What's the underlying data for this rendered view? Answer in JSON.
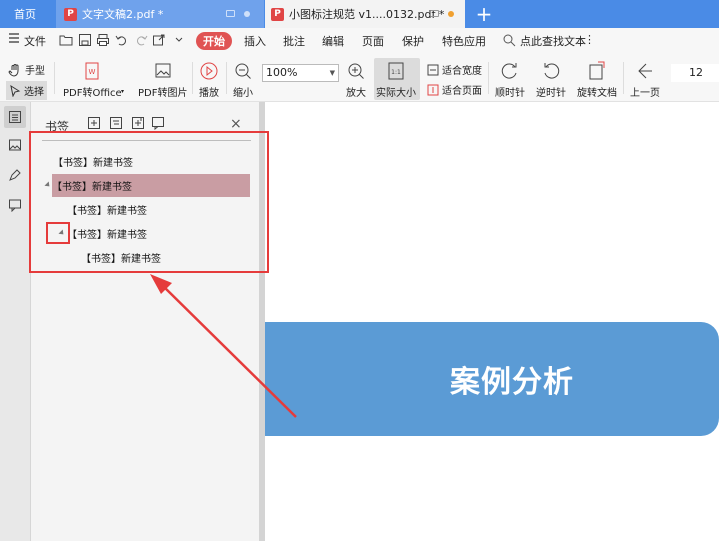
{
  "tabs": {
    "home": "首页",
    "doc1": "文字文稿2.pdf *",
    "doc2": "小图标注规范 v1....0132.pdf *",
    "add": "+"
  },
  "menu": {
    "file": "文件",
    "start": "开始",
    "insert": "插入",
    "annotate": "批注",
    "edit": "编辑",
    "page": "页面",
    "protect": "保护",
    "features": "特色应用",
    "search_placeholder": "点此查找文本",
    "more": "⋮"
  },
  "ribbon": {
    "hand": "手型",
    "select": "选择",
    "pdf_to_office": "PDF转Office",
    "pdf_to_image": "PDF转图片",
    "play": "播放",
    "zoom_out": "缩小",
    "zoom_value": "100%",
    "zoom_in": "放大",
    "actual_size": "实际大小",
    "fit_width": "适合宽度",
    "fit_page": "适合页面",
    "rotate_cw": "顺时针",
    "rotate_ccw": "逆时针",
    "rotate_doc": "旋转文档",
    "prev_page": "上一页",
    "page_number": "12",
    "actual_icon_text": "1:1"
  },
  "sidebar": {
    "title": "书签",
    "close": "×",
    "bookmarks": [
      {
        "label": "【书签】新建书签"
      },
      {
        "label": "【书签】新建书签"
      },
      {
        "label": "【书签】新建书签"
      },
      {
        "label": "【书签】新建书签"
      },
      {
        "label": "【书签】新建书签"
      }
    ]
  },
  "document": {
    "banner_text": "案例分析"
  },
  "colors": {
    "tabbar": "#4a8be6",
    "start_button": "#e05353",
    "selected_bookmark": "#c99da3",
    "banner": "#5b9bd5",
    "annotation": "#e53b3b"
  }
}
